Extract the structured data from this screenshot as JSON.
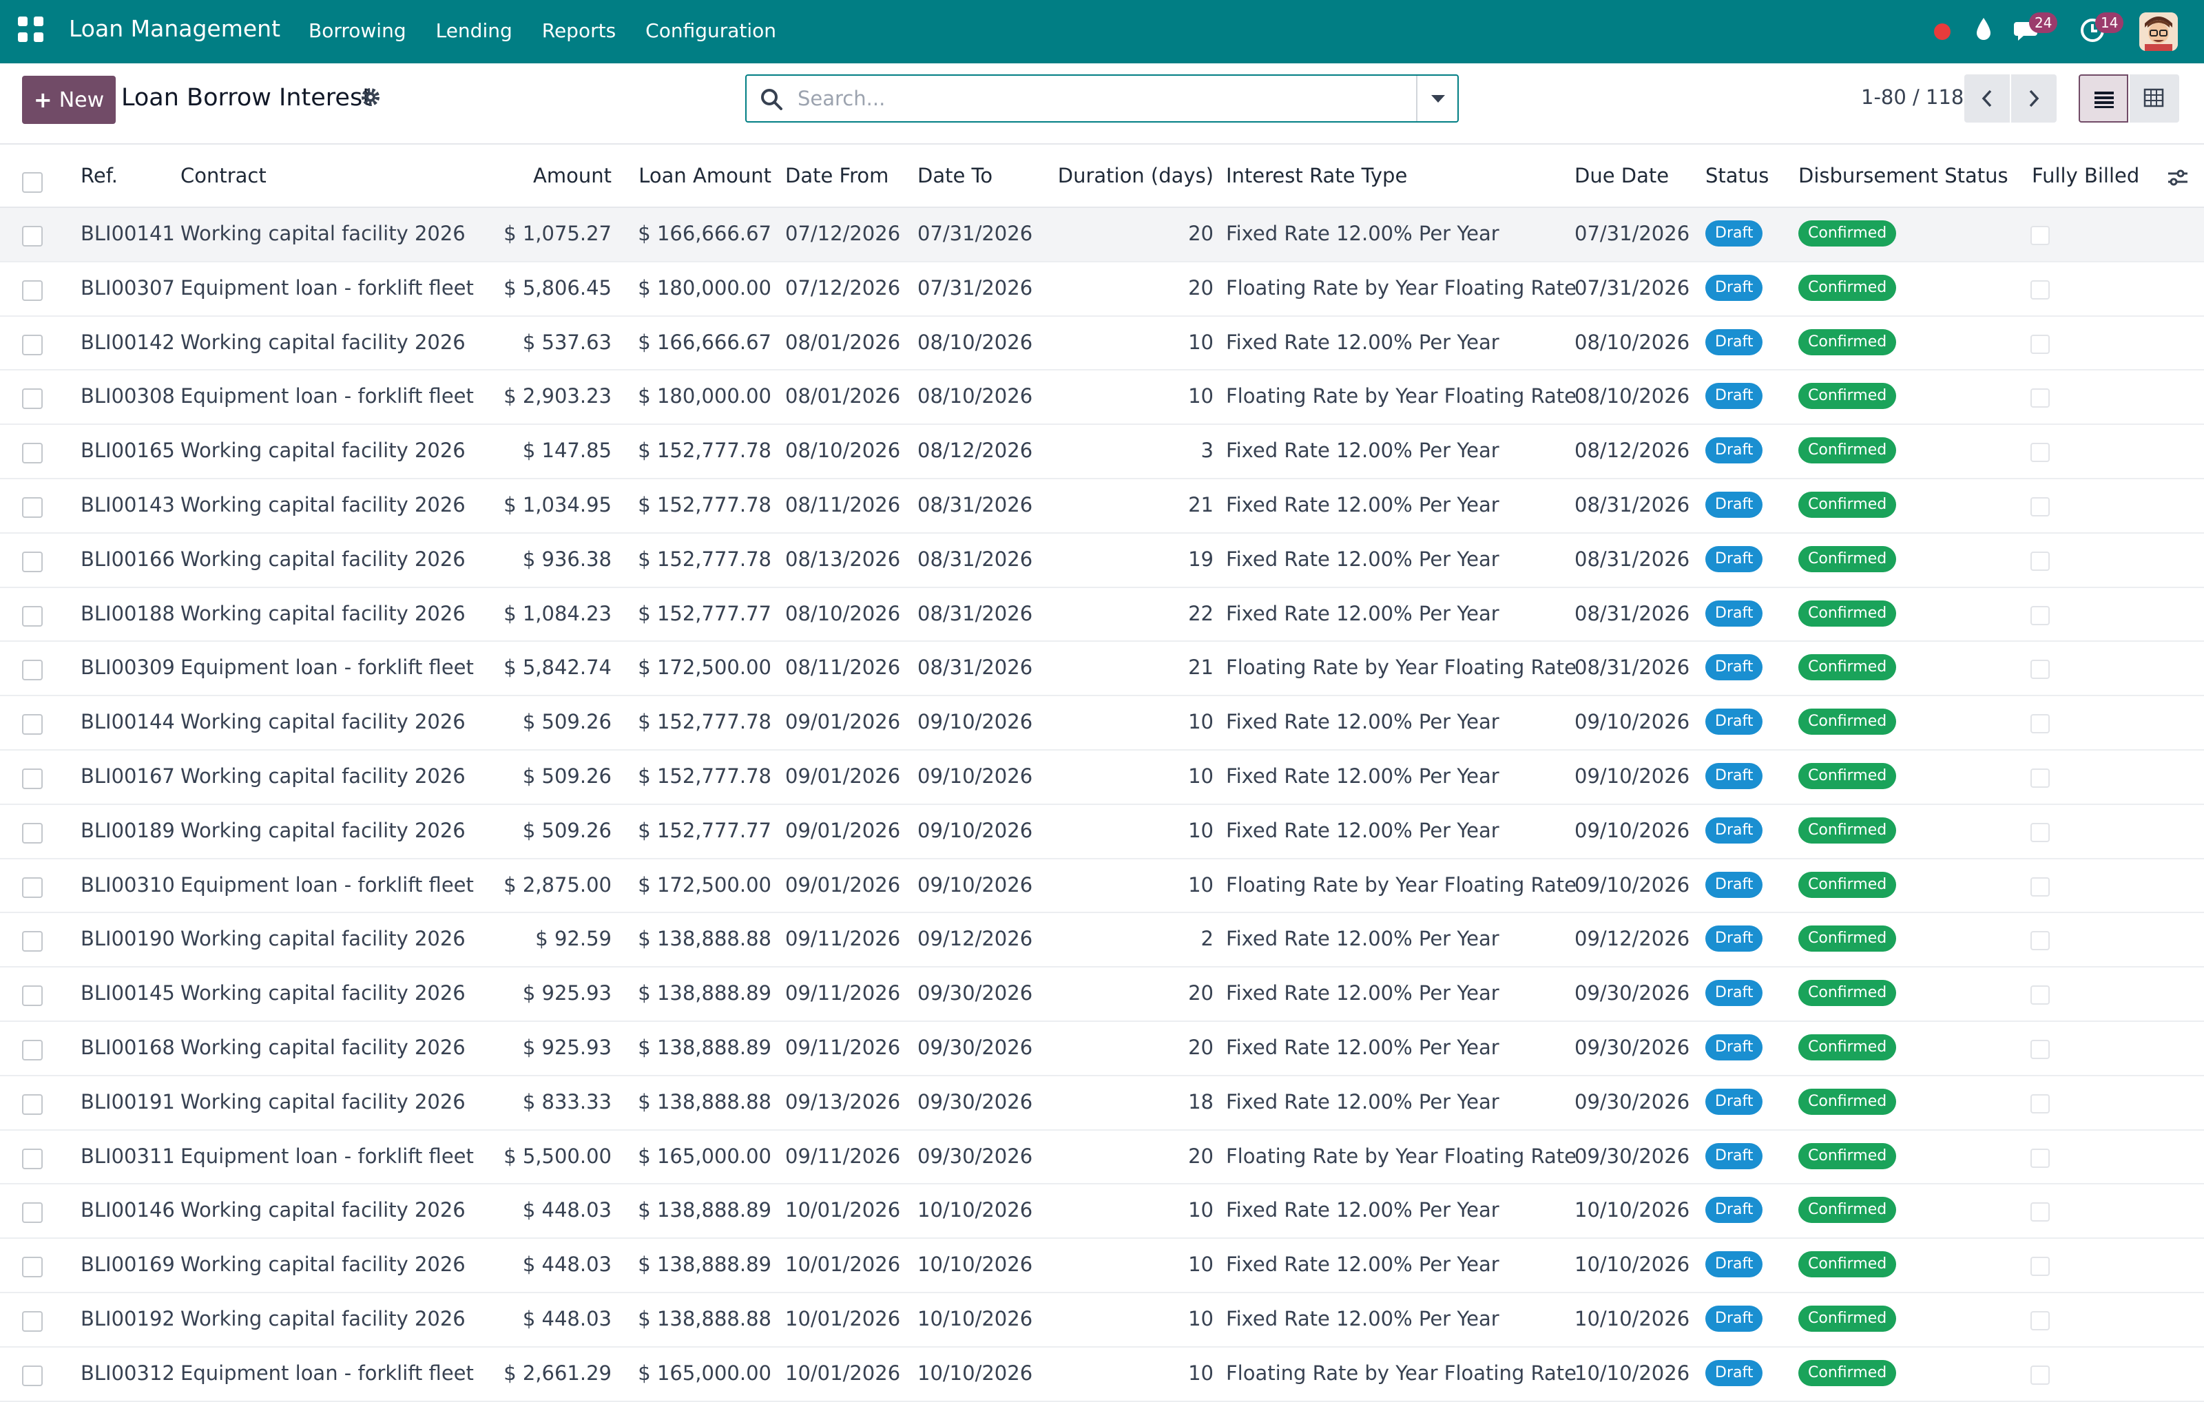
{
  "navbar": {
    "app_title": "Loan Management",
    "menu": [
      "Borrowing",
      "Lending",
      "Reports",
      "Configuration"
    ],
    "chat_badge": "24",
    "activity_badge": "14",
    "accent_color": "#017e84"
  },
  "control": {
    "new_label": "New",
    "title": "Loan Borrow Interest",
    "search_placeholder": "Search...",
    "pager": "1-80 / 118"
  },
  "table": {
    "columns": [
      "Ref.",
      "Contract",
      "Amount",
      "Loan Amount",
      "Date From",
      "Date To",
      "Duration (days)",
      "Interest Rate Type",
      "Due Date",
      "Status",
      "Disbursement Status",
      "Fully Billed"
    ],
    "rows": [
      {
        "ref": "BLI00141",
        "contract": "Working capital facility 2026",
        "amount": "$ 1,075.27",
        "loan_amount": "$ 166,666.67",
        "date_from": "07/12/2026",
        "date_to": "07/31/2026",
        "duration": "20",
        "rate_type": "Fixed Rate 12.00% Per Year",
        "due_date": "07/31/2026",
        "status": "Draft",
        "disbursement": "Confirmed"
      },
      {
        "ref": "BLI00307",
        "contract": "Equipment loan - forklift fleet",
        "amount": "$ 5,806.45",
        "loan_amount": "$ 180,000.00",
        "date_from": "07/12/2026",
        "date_to": "07/31/2026",
        "duration": "20",
        "rate_type": "Floating Rate by Year Floating Rate",
        "due_date": "07/31/2026",
        "status": "Draft",
        "disbursement": "Confirmed"
      },
      {
        "ref": "BLI00142",
        "contract": "Working capital facility 2026",
        "amount": "$ 537.63",
        "loan_amount": "$ 166,666.67",
        "date_from": "08/01/2026",
        "date_to": "08/10/2026",
        "duration": "10",
        "rate_type": "Fixed Rate 12.00% Per Year",
        "due_date": "08/10/2026",
        "status": "Draft",
        "disbursement": "Confirmed"
      },
      {
        "ref": "BLI00308",
        "contract": "Equipment loan - forklift fleet",
        "amount": "$ 2,903.23",
        "loan_amount": "$ 180,000.00",
        "date_from": "08/01/2026",
        "date_to": "08/10/2026",
        "duration": "10",
        "rate_type": "Floating Rate by Year Floating Rate",
        "due_date": "08/10/2026",
        "status": "Draft",
        "disbursement": "Confirmed"
      },
      {
        "ref": "BLI00165",
        "contract": "Working capital facility 2026",
        "amount": "$ 147.85",
        "loan_amount": "$ 152,777.78",
        "date_from": "08/10/2026",
        "date_to": "08/12/2026",
        "duration": "3",
        "rate_type": "Fixed Rate 12.00% Per Year",
        "due_date": "08/12/2026",
        "status": "Draft",
        "disbursement": "Confirmed"
      },
      {
        "ref": "BLI00143",
        "contract": "Working capital facility 2026",
        "amount": "$ 1,034.95",
        "loan_amount": "$ 152,777.78",
        "date_from": "08/11/2026",
        "date_to": "08/31/2026",
        "duration": "21",
        "rate_type": "Fixed Rate 12.00% Per Year",
        "due_date": "08/31/2026",
        "status": "Draft",
        "disbursement": "Confirmed"
      },
      {
        "ref": "BLI00166",
        "contract": "Working capital facility 2026",
        "amount": "$ 936.38",
        "loan_amount": "$ 152,777.78",
        "date_from": "08/13/2026",
        "date_to": "08/31/2026",
        "duration": "19",
        "rate_type": "Fixed Rate 12.00% Per Year",
        "due_date": "08/31/2026",
        "status": "Draft",
        "disbursement": "Confirmed"
      },
      {
        "ref": "BLI00188",
        "contract": "Working capital facility 2026",
        "amount": "$ 1,084.23",
        "loan_amount": "$ 152,777.77",
        "date_from": "08/10/2026",
        "date_to": "08/31/2026",
        "duration": "22",
        "rate_type": "Fixed Rate 12.00% Per Year",
        "due_date": "08/31/2026",
        "status": "Draft",
        "disbursement": "Confirmed"
      },
      {
        "ref": "BLI00309",
        "contract": "Equipment loan - forklift fleet",
        "amount": "$ 5,842.74",
        "loan_amount": "$ 172,500.00",
        "date_from": "08/11/2026",
        "date_to": "08/31/2026",
        "duration": "21",
        "rate_type": "Floating Rate by Year Floating Rate",
        "due_date": "08/31/2026",
        "status": "Draft",
        "disbursement": "Confirmed"
      },
      {
        "ref": "BLI00144",
        "contract": "Working capital facility 2026",
        "amount": "$ 509.26",
        "loan_amount": "$ 152,777.78",
        "date_from": "09/01/2026",
        "date_to": "09/10/2026",
        "duration": "10",
        "rate_type": "Fixed Rate 12.00% Per Year",
        "due_date": "09/10/2026",
        "status": "Draft",
        "disbursement": "Confirmed"
      },
      {
        "ref": "BLI00167",
        "contract": "Working capital facility 2026",
        "amount": "$ 509.26",
        "loan_amount": "$ 152,777.78",
        "date_from": "09/01/2026",
        "date_to": "09/10/2026",
        "duration": "10",
        "rate_type": "Fixed Rate 12.00% Per Year",
        "due_date": "09/10/2026",
        "status": "Draft",
        "disbursement": "Confirmed"
      },
      {
        "ref": "BLI00189",
        "contract": "Working capital facility 2026",
        "amount": "$ 509.26",
        "loan_amount": "$ 152,777.77",
        "date_from": "09/01/2026",
        "date_to": "09/10/2026",
        "duration": "10",
        "rate_type": "Fixed Rate 12.00% Per Year",
        "due_date": "09/10/2026",
        "status": "Draft",
        "disbursement": "Confirmed"
      },
      {
        "ref": "BLI00310",
        "contract": "Equipment loan - forklift fleet",
        "amount": "$ 2,875.00",
        "loan_amount": "$ 172,500.00",
        "date_from": "09/01/2026",
        "date_to": "09/10/2026",
        "duration": "10",
        "rate_type": "Floating Rate by Year Floating Rate",
        "due_date": "09/10/2026",
        "status": "Draft",
        "disbursement": "Confirmed"
      },
      {
        "ref": "BLI00190",
        "contract": "Working capital facility 2026",
        "amount": "$ 92.59",
        "loan_amount": "$ 138,888.88",
        "date_from": "09/11/2026",
        "date_to": "09/12/2026",
        "duration": "2",
        "rate_type": "Fixed Rate 12.00% Per Year",
        "due_date": "09/12/2026",
        "status": "Draft",
        "disbursement": "Confirmed"
      },
      {
        "ref": "BLI00145",
        "contract": "Working capital facility 2026",
        "amount": "$ 925.93",
        "loan_amount": "$ 138,888.89",
        "date_from": "09/11/2026",
        "date_to": "09/30/2026",
        "duration": "20",
        "rate_type": "Fixed Rate 12.00% Per Year",
        "due_date": "09/30/2026",
        "status": "Draft",
        "disbursement": "Confirmed"
      },
      {
        "ref": "BLI00168",
        "contract": "Working capital facility 2026",
        "amount": "$ 925.93",
        "loan_amount": "$ 138,888.89",
        "date_from": "09/11/2026",
        "date_to": "09/30/2026",
        "duration": "20",
        "rate_type": "Fixed Rate 12.00% Per Year",
        "due_date": "09/30/2026",
        "status": "Draft",
        "disbursement": "Confirmed"
      },
      {
        "ref": "BLI00191",
        "contract": "Working capital facility 2026",
        "amount": "$ 833.33",
        "loan_amount": "$ 138,888.88",
        "date_from": "09/13/2026",
        "date_to": "09/30/2026",
        "duration": "18",
        "rate_type": "Fixed Rate 12.00% Per Year",
        "due_date": "09/30/2026",
        "status": "Draft",
        "disbursement": "Confirmed"
      },
      {
        "ref": "BLI00311",
        "contract": "Equipment loan - forklift fleet",
        "amount": "$ 5,500.00",
        "loan_amount": "$ 165,000.00",
        "date_from": "09/11/2026",
        "date_to": "09/30/2026",
        "duration": "20",
        "rate_type": "Floating Rate by Year Floating Rate",
        "due_date": "09/30/2026",
        "status": "Draft",
        "disbursement": "Confirmed"
      },
      {
        "ref": "BLI00146",
        "contract": "Working capital facility 2026",
        "amount": "$ 448.03",
        "loan_amount": "$ 138,888.89",
        "date_from": "10/01/2026",
        "date_to": "10/10/2026",
        "duration": "10",
        "rate_type": "Fixed Rate 12.00% Per Year",
        "due_date": "10/10/2026",
        "status": "Draft",
        "disbursement": "Confirmed"
      },
      {
        "ref": "BLI00169",
        "contract": "Working capital facility 2026",
        "amount": "$ 448.03",
        "loan_amount": "$ 138,888.89",
        "date_from": "10/01/2026",
        "date_to": "10/10/2026",
        "duration": "10",
        "rate_type": "Fixed Rate 12.00% Per Year",
        "due_date": "10/10/2026",
        "status": "Draft",
        "disbursement": "Confirmed"
      },
      {
        "ref": "BLI00192",
        "contract": "Working capital facility 2026",
        "amount": "$ 448.03",
        "loan_amount": "$ 138,888.88",
        "date_from": "10/01/2026",
        "date_to": "10/10/2026",
        "duration": "10",
        "rate_type": "Fixed Rate 12.00% Per Year",
        "due_date": "10/10/2026",
        "status": "Draft",
        "disbursement": "Confirmed"
      },
      {
        "ref": "BLI00312",
        "contract": "Equipment loan - forklift fleet",
        "amount": "$ 2,661.29",
        "loan_amount": "$ 165,000.00",
        "date_from": "10/01/2026",
        "date_to": "10/10/2026",
        "duration": "10",
        "rate_type": "Floating Rate by Year Floating Rate",
        "due_date": "10/10/2026",
        "status": "Draft",
        "disbursement": "Confirmed"
      }
    ]
  }
}
